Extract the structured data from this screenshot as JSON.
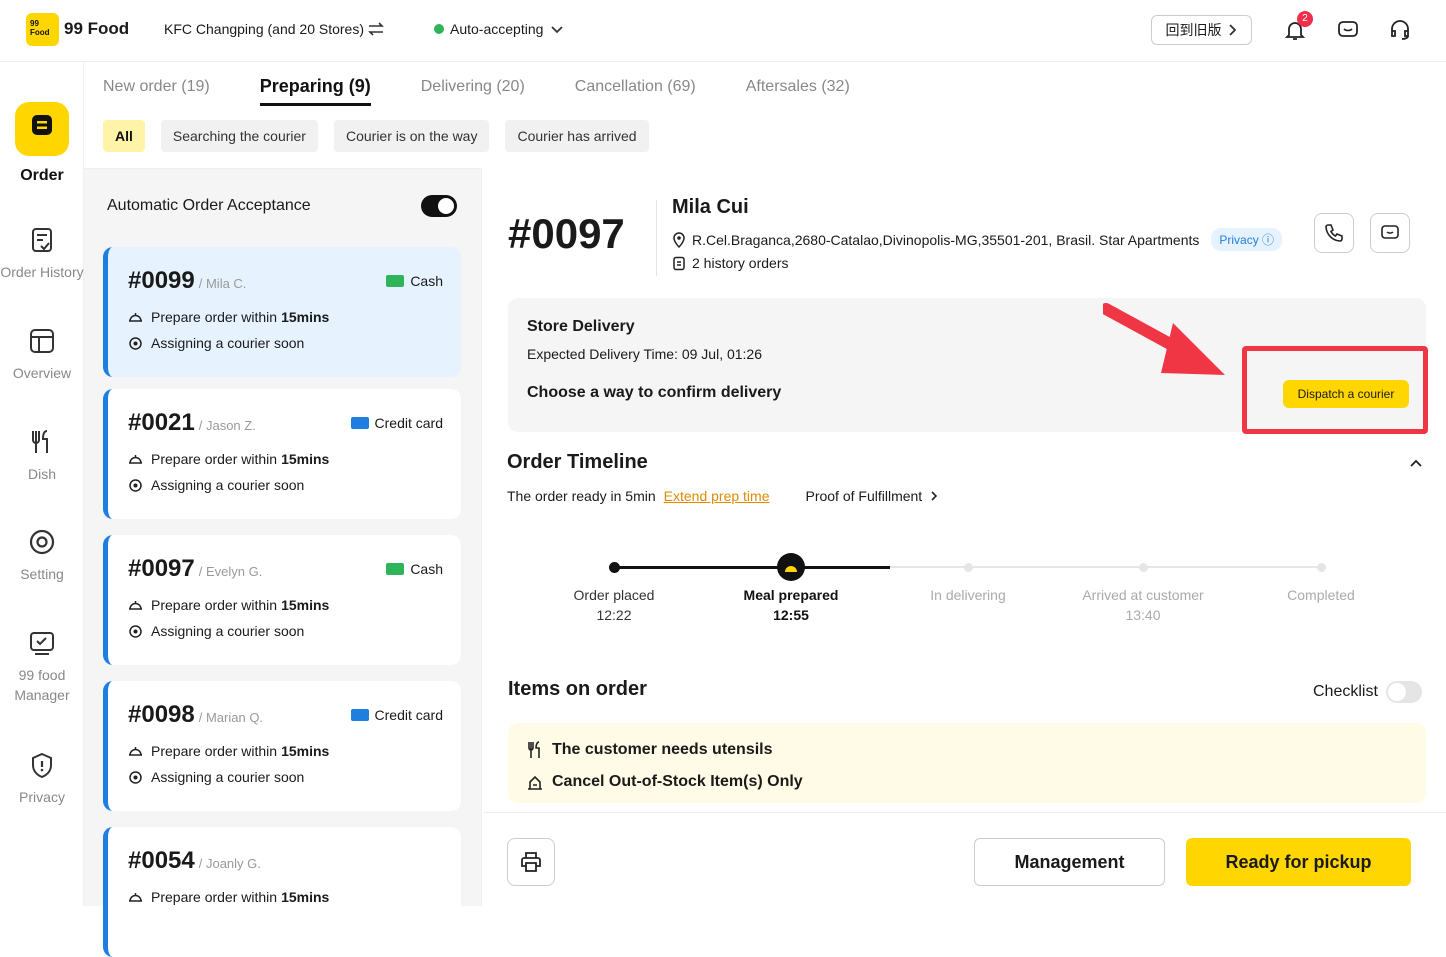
{
  "header": {
    "logo_text": "99 Food",
    "brand": "99 Food",
    "store": "KFC Changping (and 20 Stores)",
    "auto_status": "Auto-accepting",
    "old_version": "回到旧版",
    "notification_count": "2"
  },
  "sidebar": {
    "items": [
      {
        "label": "Order",
        "icon": "order-icon"
      },
      {
        "label": "Order History",
        "icon": "order-history-icon"
      },
      {
        "label": "Overview",
        "icon": "overview-icon"
      },
      {
        "label": "Dish",
        "icon": "dish-icon"
      },
      {
        "label": "Setting",
        "icon": "setting-icon"
      },
      {
        "label": "99 food Manager",
        "icon": "manager-icon"
      },
      {
        "label": "Privacy",
        "icon": "privacy-icon"
      }
    ]
  },
  "tabs": [
    "New order (19)",
    "Preparing (9)",
    "Delivering (20)",
    "Cancellation (69)",
    "Aftersales (32)"
  ],
  "filters": [
    "All",
    "Searching the courier",
    "Courier is on the way",
    "Courier has arrived"
  ],
  "order_list": {
    "auto_accept_label": "Automatic Order Acceptance",
    "orders": [
      {
        "number": "#0099",
        "customer": "/ Mila C.",
        "payment": "Cash",
        "prepare": "Prepare order within",
        "mins": "15mins",
        "courier": "Assigning a courier soon"
      },
      {
        "number": "#0021",
        "customer": "/ Jason Z.",
        "payment": "Credit card",
        "prepare": "Prepare order within",
        "mins": "15mins",
        "courier": "Assigning a courier soon"
      },
      {
        "number": "#0097",
        "customer": "/ Evelyn G.",
        "payment": "Cash",
        "prepare": "Prepare order within",
        "mins": "15mins",
        "courier": "Assigning a courier soon"
      },
      {
        "number": "#0098",
        "customer": "/ Marian Q.",
        "payment": "Credit card",
        "prepare": "Prepare order within",
        "mins": "15mins",
        "courier": "Assigning a courier soon"
      },
      {
        "number": "#0054",
        "customer": "/ Joanly G.",
        "payment": "",
        "prepare": "Prepare order within",
        "mins": "15mins",
        "courier": ""
      }
    ]
  },
  "detail": {
    "order_number": "#0097",
    "customer_name": "Mila Cui",
    "address": "R.Cel.Braganca,2680-Catalao,Divinopolis-MG,35501-201, Brasil. Star Apartments",
    "privacy_label": "Privacy",
    "history": "2 history orders",
    "delivery_type": "Store Delivery",
    "expected_time": "Expected Delivery Time: 09 Jul, 01:26",
    "choose_way": "Choose a way to confirm delivery",
    "dispatch_label": "Dispatch a courier",
    "timeline_title": "Order Timeline",
    "ready_in": "The order ready in 5min",
    "extend_label": "Extend prep time",
    "proof_label": "Proof of Fulfillment",
    "timeline": [
      {
        "label": "Order placed",
        "time": "12:22"
      },
      {
        "label": "Meal prepared",
        "time": "12:55"
      },
      {
        "label": "In delivering",
        "time": ""
      },
      {
        "label": "Arrived at customer",
        "time": "13:40"
      },
      {
        "label": "Completed",
        "time": ""
      }
    ],
    "items_title": "Items on order",
    "checklist_label": "Checklist",
    "notes": [
      "The customer needs utensils",
      "Cancel Out-of-Stock Item(s) Only"
    ]
  },
  "footer": {
    "management_label": "Management",
    "ready_label": "Ready for pickup"
  },
  "colors": {
    "brand_yellow": "#ffd600",
    "accent_blue": "#1f7fe0",
    "alert_red": "#f03545",
    "online_green": "#2fb45a"
  }
}
